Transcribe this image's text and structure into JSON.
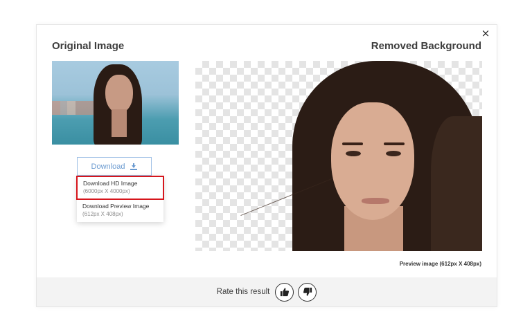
{
  "modal": {
    "close_label": "×",
    "left_title": "Original Image",
    "right_title": "Removed Background"
  },
  "download": {
    "button_label": "Download",
    "icon": "download-icon",
    "options": [
      {
        "label": "Download HD Image",
        "size": "(6000px X 4000px)",
        "highlighted": true
      },
      {
        "label": "Download Preview Image",
        "size": "(612px X 408px)",
        "highlighted": false
      }
    ]
  },
  "preview": {
    "caption": "Preview image (612px X 408px)"
  },
  "footer": {
    "rate_label": "Rate this result",
    "thumbs_up_icon": "thumbs-up-icon",
    "thumbs_down_icon": "thumbs-down-icon"
  },
  "colors": {
    "accent": "#6a9ad0",
    "highlight_border": "#d6151c",
    "footer_bg": "#f3f3f3"
  }
}
